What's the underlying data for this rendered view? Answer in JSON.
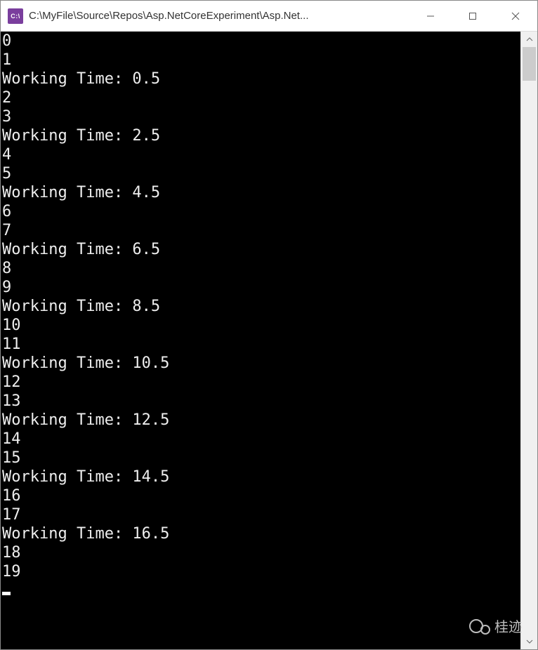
{
  "window": {
    "icon_text": "C:\\",
    "title": "C:\\MyFile\\Source\\Repos\\Asp.NetCoreExperiment\\Asp.Net..."
  },
  "console": {
    "lines": [
      "0",
      "1",
      "Working Time: 0.5",
      "2",
      "3",
      "Working Time: 2.5",
      "4",
      "5",
      "Working Time: 4.5",
      "6",
      "7",
      "Working Time: 6.5",
      "8",
      "9",
      "Working Time: 8.5",
      "10",
      "11",
      "Working Time: 10.5",
      "12",
      "13",
      "Working Time: 12.5",
      "14",
      "15",
      "Working Time: 14.5",
      "16",
      "17",
      "Working Time: 16.5",
      "18",
      "19"
    ]
  },
  "watermark": {
    "text": "桂迹"
  }
}
